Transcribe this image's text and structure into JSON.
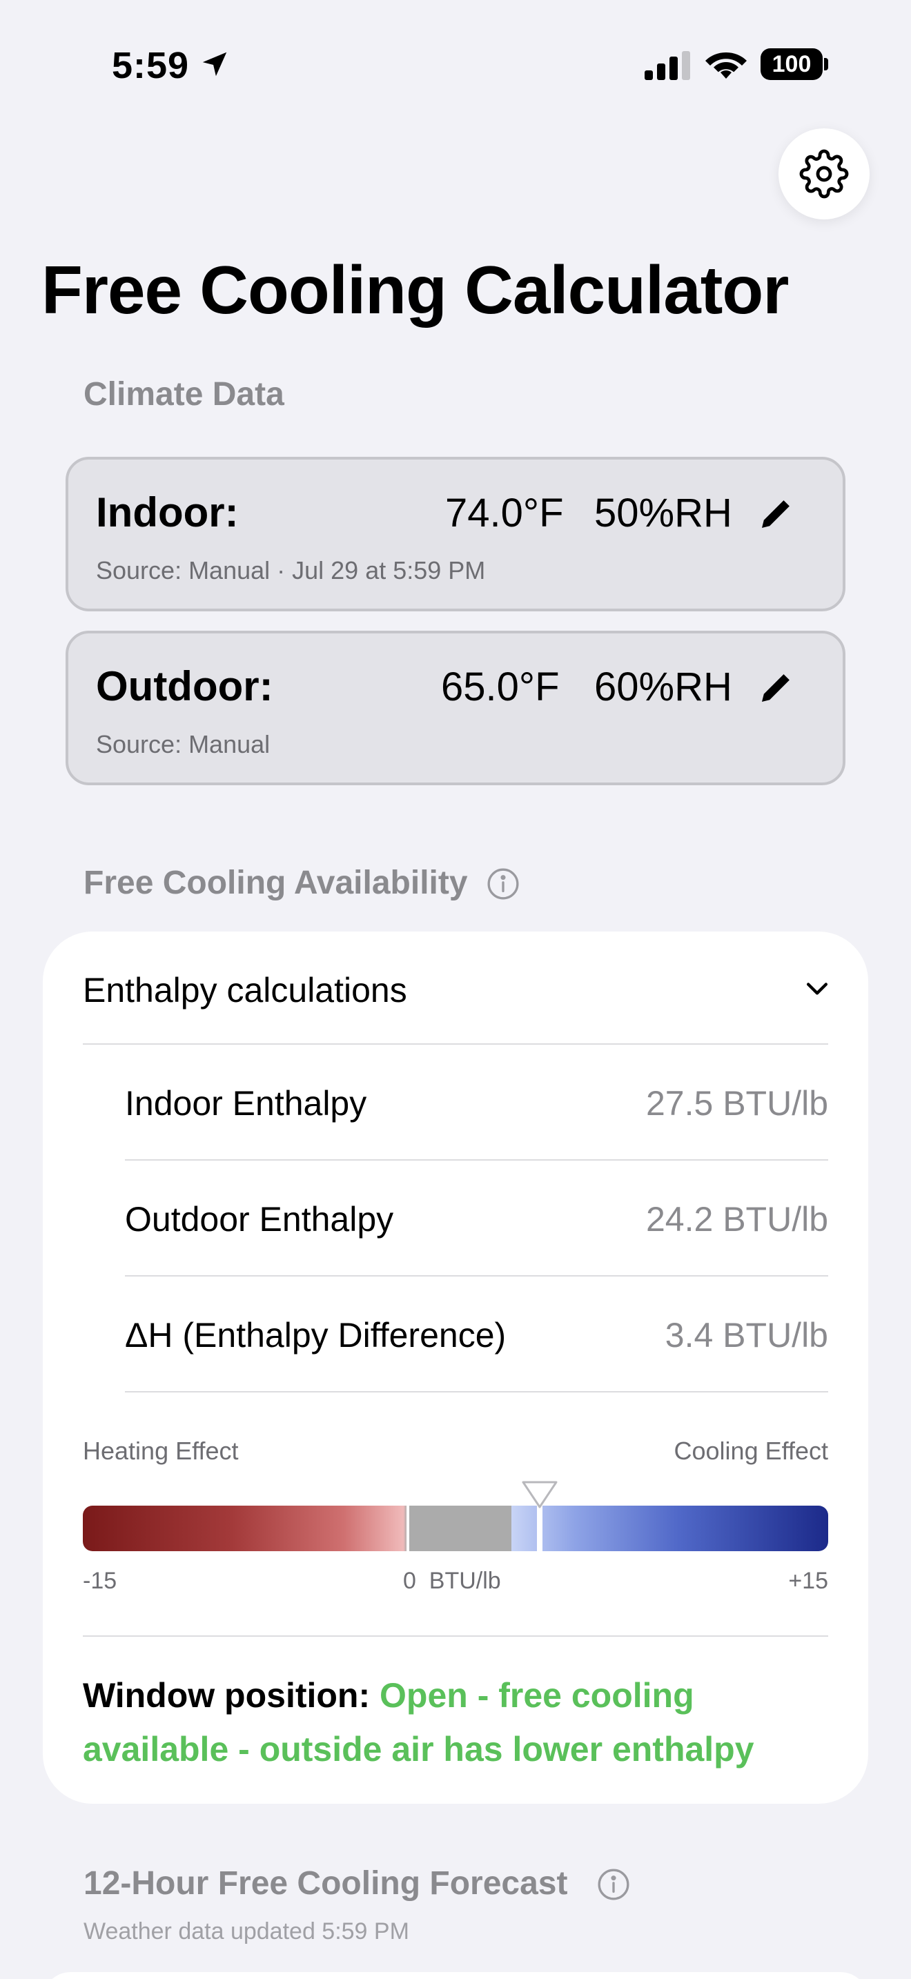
{
  "status_bar": {
    "time": "5:59",
    "battery": "100"
  },
  "page_title": "Free Cooling Calculator",
  "climate_section": {
    "header": "Climate Data",
    "indoor": {
      "label": "Indoor:",
      "temp": "74.0°F",
      "rh": "50%RH",
      "source": "Source: Manual  ·  Jul 29 at 5:59 PM"
    },
    "outdoor": {
      "label": "Outdoor:",
      "temp": "65.0°F",
      "rh": "60%RH",
      "source": "Source: Manual"
    }
  },
  "availability": {
    "header": "Free Cooling Availability",
    "disclosure_label": "Enthalpy calculations",
    "rows": [
      {
        "label": "Indoor Enthalpy",
        "value": "27.5 BTU/lb"
      },
      {
        "label": "Outdoor Enthalpy",
        "value": "24.2 BTU/lb"
      },
      {
        "label": "ΔH (Enthalpy Difference)",
        "value": "3.4 BTU/lb"
      }
    ],
    "gauge": {
      "left_label": "Heating Effect",
      "right_label": "Cooling Effect",
      "min_label": "-15",
      "zero_label": "0  BTU/lb",
      "max_label": "+15",
      "min": -15,
      "max": 15,
      "value": 3.4
    },
    "window_position": {
      "label": "Window position: ",
      "status": "Open - free cooling available - outside air has lower enthalpy"
    }
  },
  "forecast": {
    "header": "12-Hour Free Cooling Forecast",
    "updated": "Weather data updated 5:59 PM"
  },
  "colors": {
    "background": "#f2f2f7",
    "status_green": "#5ac05a",
    "heating_dark": "#7a1a1a",
    "cooling_dark": "#1c2a8a"
  }
}
